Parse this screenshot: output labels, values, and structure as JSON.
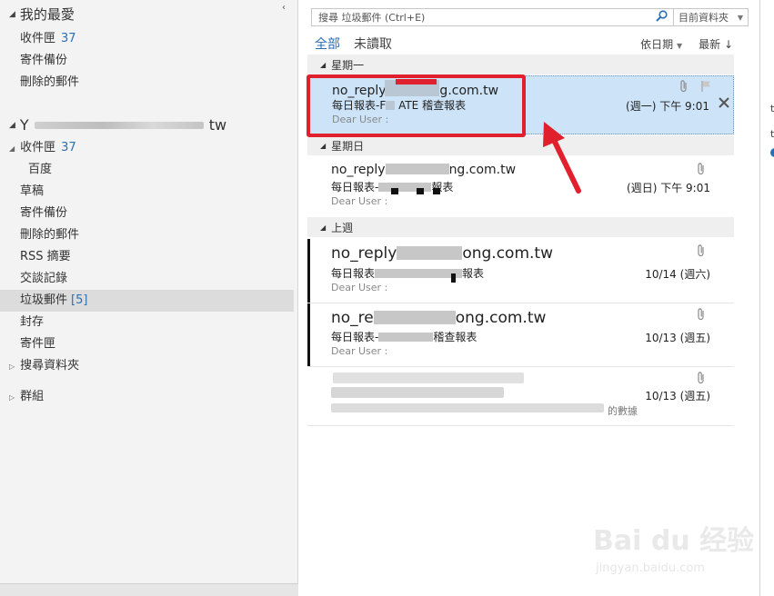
{
  "folder_pane": {
    "collapse_glyph": "‹",
    "favorites": {
      "header": "我的最愛",
      "items": [
        {
          "label": "收件匣",
          "count": "37"
        },
        {
          "label": "寄件備份",
          "count": ""
        },
        {
          "label": "刪除的郵件",
          "count": ""
        }
      ]
    },
    "account": {
      "name_start": "Y",
      "name_end": "tw",
      "items": [
        {
          "label": "收件匣",
          "count": "37"
        },
        {
          "label": "百度",
          "count": ""
        },
        {
          "label": "草稿",
          "count": ""
        },
        {
          "label": "寄件備份",
          "count": ""
        },
        {
          "label": "刪除的郵件",
          "count": ""
        },
        {
          "label": "RSS 摘要",
          "count": ""
        },
        {
          "label": "交談記錄",
          "count": ""
        },
        {
          "label": "垃圾郵件",
          "count": "[5]"
        },
        {
          "label": "封存",
          "count": ""
        },
        {
          "label": "寄件匣",
          "count": ""
        },
        {
          "label": "搜尋資料夾",
          "count": ""
        }
      ]
    },
    "groups_label": "群組"
  },
  "search": {
    "placeholder": "搜尋 垃圾郵件 (Ctrl+E)",
    "scope": "目前資料夾"
  },
  "filters": {
    "all": "全部",
    "unread": "未讀取",
    "sort_by": "依日期",
    "sort_order": "最新 ↓"
  },
  "groups": [
    "星期一",
    "星期日",
    "上週"
  ],
  "messages": [
    {
      "sender_start": "no_reply",
      "sender_end": "ng.com.tw",
      "subject_start": "每日報表-F",
      "subject_end": "ATE 稽查報表",
      "preview": "Dear User :",
      "date": "(週一) 下午 9:01"
    },
    {
      "sender_start": "no_reply",
      "sender_end": "ng.com.tw",
      "subject_start": "每日報表-",
      "subject_end": "報表",
      "preview": "Dear User :",
      "date": "(週日) 下午 9:01"
    },
    {
      "sender_start": "no_reply",
      "sender_end": "ong.com.tw",
      "subject_start": "每日報表",
      "subject_end": "報表",
      "preview": "Dear User :",
      "date": "10/14 (週六)"
    },
    {
      "sender_start": "no_re",
      "sender_end": "ong.com.tw",
      "subject_start": "每日報表-",
      "subject_end": "稽查報表",
      "preview": "Dear User :",
      "date": "10/13 (週五)"
    },
    {
      "sender_start": "",
      "sender_end": "",
      "subject_start": "",
      "subject_end": "",
      "preview": "的數據",
      "date": "10/13 (週五)"
    }
  ],
  "reading_pane": {
    "fragments": [
      "t",
      "t"
    ]
  },
  "watermark": {
    "brand": "Bai du 经验",
    "url": "jingyan.baidu.com"
  },
  "colors": {
    "accent": "#2a6fb5",
    "selection": "#cde3f7",
    "highlight": "#e0202c"
  }
}
